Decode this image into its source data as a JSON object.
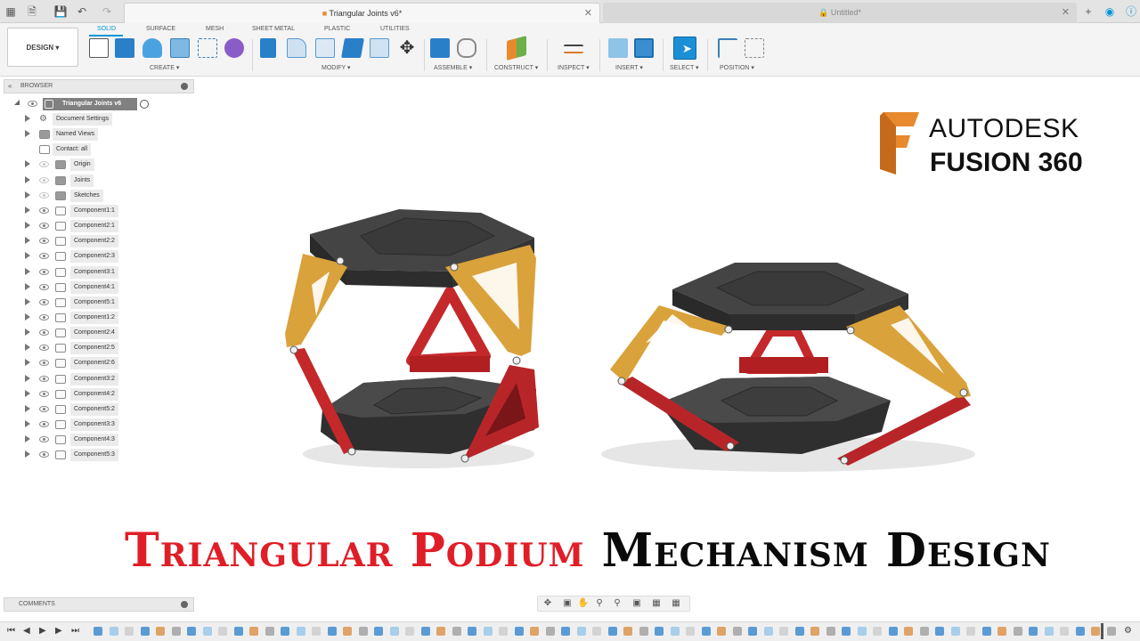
{
  "tabs": {
    "active_title": "Triangular Joints v6*",
    "inactive_title": "Untitled*"
  },
  "ribbon": {
    "workspace": "DESIGN",
    "tabs": [
      "SOLID",
      "SURFACE",
      "MESH",
      "SHEET METAL",
      "PLASTIC",
      "UTILITIES"
    ],
    "groups": {
      "create": "CREATE",
      "modify": "MODIFY",
      "assemble": "ASSEMBLE",
      "construct": "CONSTRUCT",
      "inspect": "INSPECT",
      "insert": "INSERT",
      "select": "SELECT",
      "position": "POSITION"
    }
  },
  "browser": {
    "header": "BROWSER",
    "root": "Triangular Joints v6",
    "items": [
      {
        "label": "Document Settings",
        "icon": "gear-icon"
      },
      {
        "label": "Named Views",
        "icon": "folder-icon"
      },
      {
        "label": "Contact: all",
        "icon": "contact-icon"
      },
      {
        "label": "Origin",
        "icon": "folder-icon"
      },
      {
        "label": "Joints",
        "icon": "folder-icon"
      },
      {
        "label": "Sketches",
        "icon": "folder-icon"
      },
      {
        "label": "Component1:1",
        "icon": "component-icon"
      },
      {
        "label": "Component2:1",
        "icon": "component-icon"
      },
      {
        "label": "Component2:2",
        "icon": "component-icon"
      },
      {
        "label": "Component2:3",
        "icon": "component-icon"
      },
      {
        "label": "Component3:1",
        "icon": "component-icon"
      },
      {
        "label": "Component4:1",
        "icon": "component-icon"
      },
      {
        "label": "Component5:1",
        "icon": "component-icon"
      },
      {
        "label": "Component1:2",
        "icon": "component-icon"
      },
      {
        "label": "Component2:4",
        "icon": "component-icon"
      },
      {
        "label": "Component2:5",
        "icon": "component-icon"
      },
      {
        "label": "Component2:6",
        "icon": "component-icon"
      },
      {
        "label": "Component3:2",
        "icon": "component-icon"
      },
      {
        "label": "Component4:2",
        "icon": "component-icon"
      },
      {
        "label": "Component5:2",
        "icon": "component-icon"
      },
      {
        "label": "Component3:3",
        "icon": "component-icon"
      },
      {
        "label": "Component4:3",
        "icon": "component-icon"
      },
      {
        "label": "Component5:3",
        "icon": "component-icon"
      }
    ]
  },
  "comments": {
    "header": "COMMENTS"
  },
  "branding": {
    "line1": "AUTODESK",
    "line2": "FUSION 360"
  },
  "overlay_title": {
    "red_part": "Triangular Podium",
    "black_part": "Mechanism Design"
  },
  "colors": {
    "accent": "#0696d7",
    "title_red": "#e01e27",
    "link_orange": "#d9a23b",
    "link_red": "#c4282b",
    "plate_dark": "#3b3b3b"
  }
}
